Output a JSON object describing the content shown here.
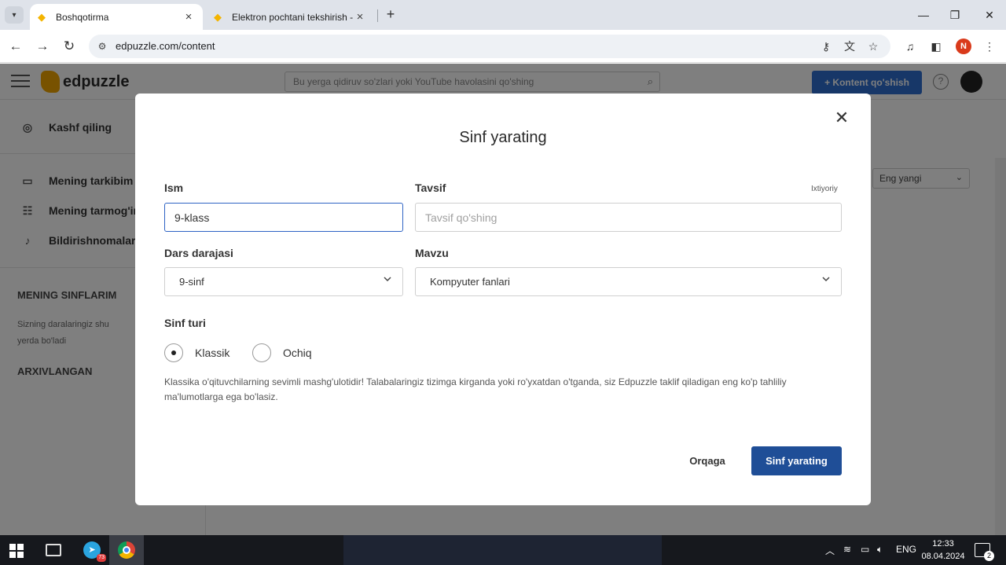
{
  "browser": {
    "tabs": [
      {
        "title": "Boshqotirma",
        "active": true
      },
      {
        "title": "Elektron pochtani tekshirish - E",
        "active": false
      }
    ],
    "url": "edpuzzle.com/content",
    "profile_initial": "N"
  },
  "app": {
    "logo": "edpuzzle",
    "search_placeholder": "Bu yerga qidiruv so'zlari yoki YouTube havolasini qo'shing",
    "add_content_label": "+ Kontent qo'shish",
    "help_label": "?",
    "sort_label": "Eng yangi",
    "sidebar": {
      "explore": "Kashf qiling",
      "items": [
        "Mening tarkibim",
        "Mening tarmog'im",
        "Bildirishnomalar"
      ],
      "my_classes_heading": "MENING SINFLARIM",
      "my_classes_note": "Sizning daralaringiz shu yerda bo'ladi",
      "archived_heading": "ARXIVLANGAN"
    }
  },
  "modal": {
    "title": "Sinf yarating",
    "name_label": "Ism",
    "name_value": "9-klass",
    "description_label": "Tavsif",
    "optional_label": "Ixtiyoriy",
    "description_placeholder": "Tavsif qo'shing",
    "grade_label": "Dars darajasi",
    "grade_value": "9-sinf",
    "subject_label": "Mavzu",
    "subject_value": "Kompyuter fanlari",
    "class_type_label": "Sinf turi",
    "class_types": [
      "Klassik",
      "Ochiq"
    ],
    "selected_class_type": "Klassik",
    "description_text": "Klassika o'qituvchilarning sevimli mashg'ulotidir! Talabalaringiz tizimga kirganda yoki ro'yxatdan o'tganda, siz Edpuzzle taklif qiladigan eng ko'p tahliliy ma'lumotlarga ega bo'lasiz.",
    "back_label": "Orqaga",
    "submit_label": "Sinf yarating"
  },
  "taskbar": {
    "telegram_badge": "73",
    "language": "ENG",
    "time": "12:33",
    "date": "08.04.2024",
    "notifications": "2"
  }
}
